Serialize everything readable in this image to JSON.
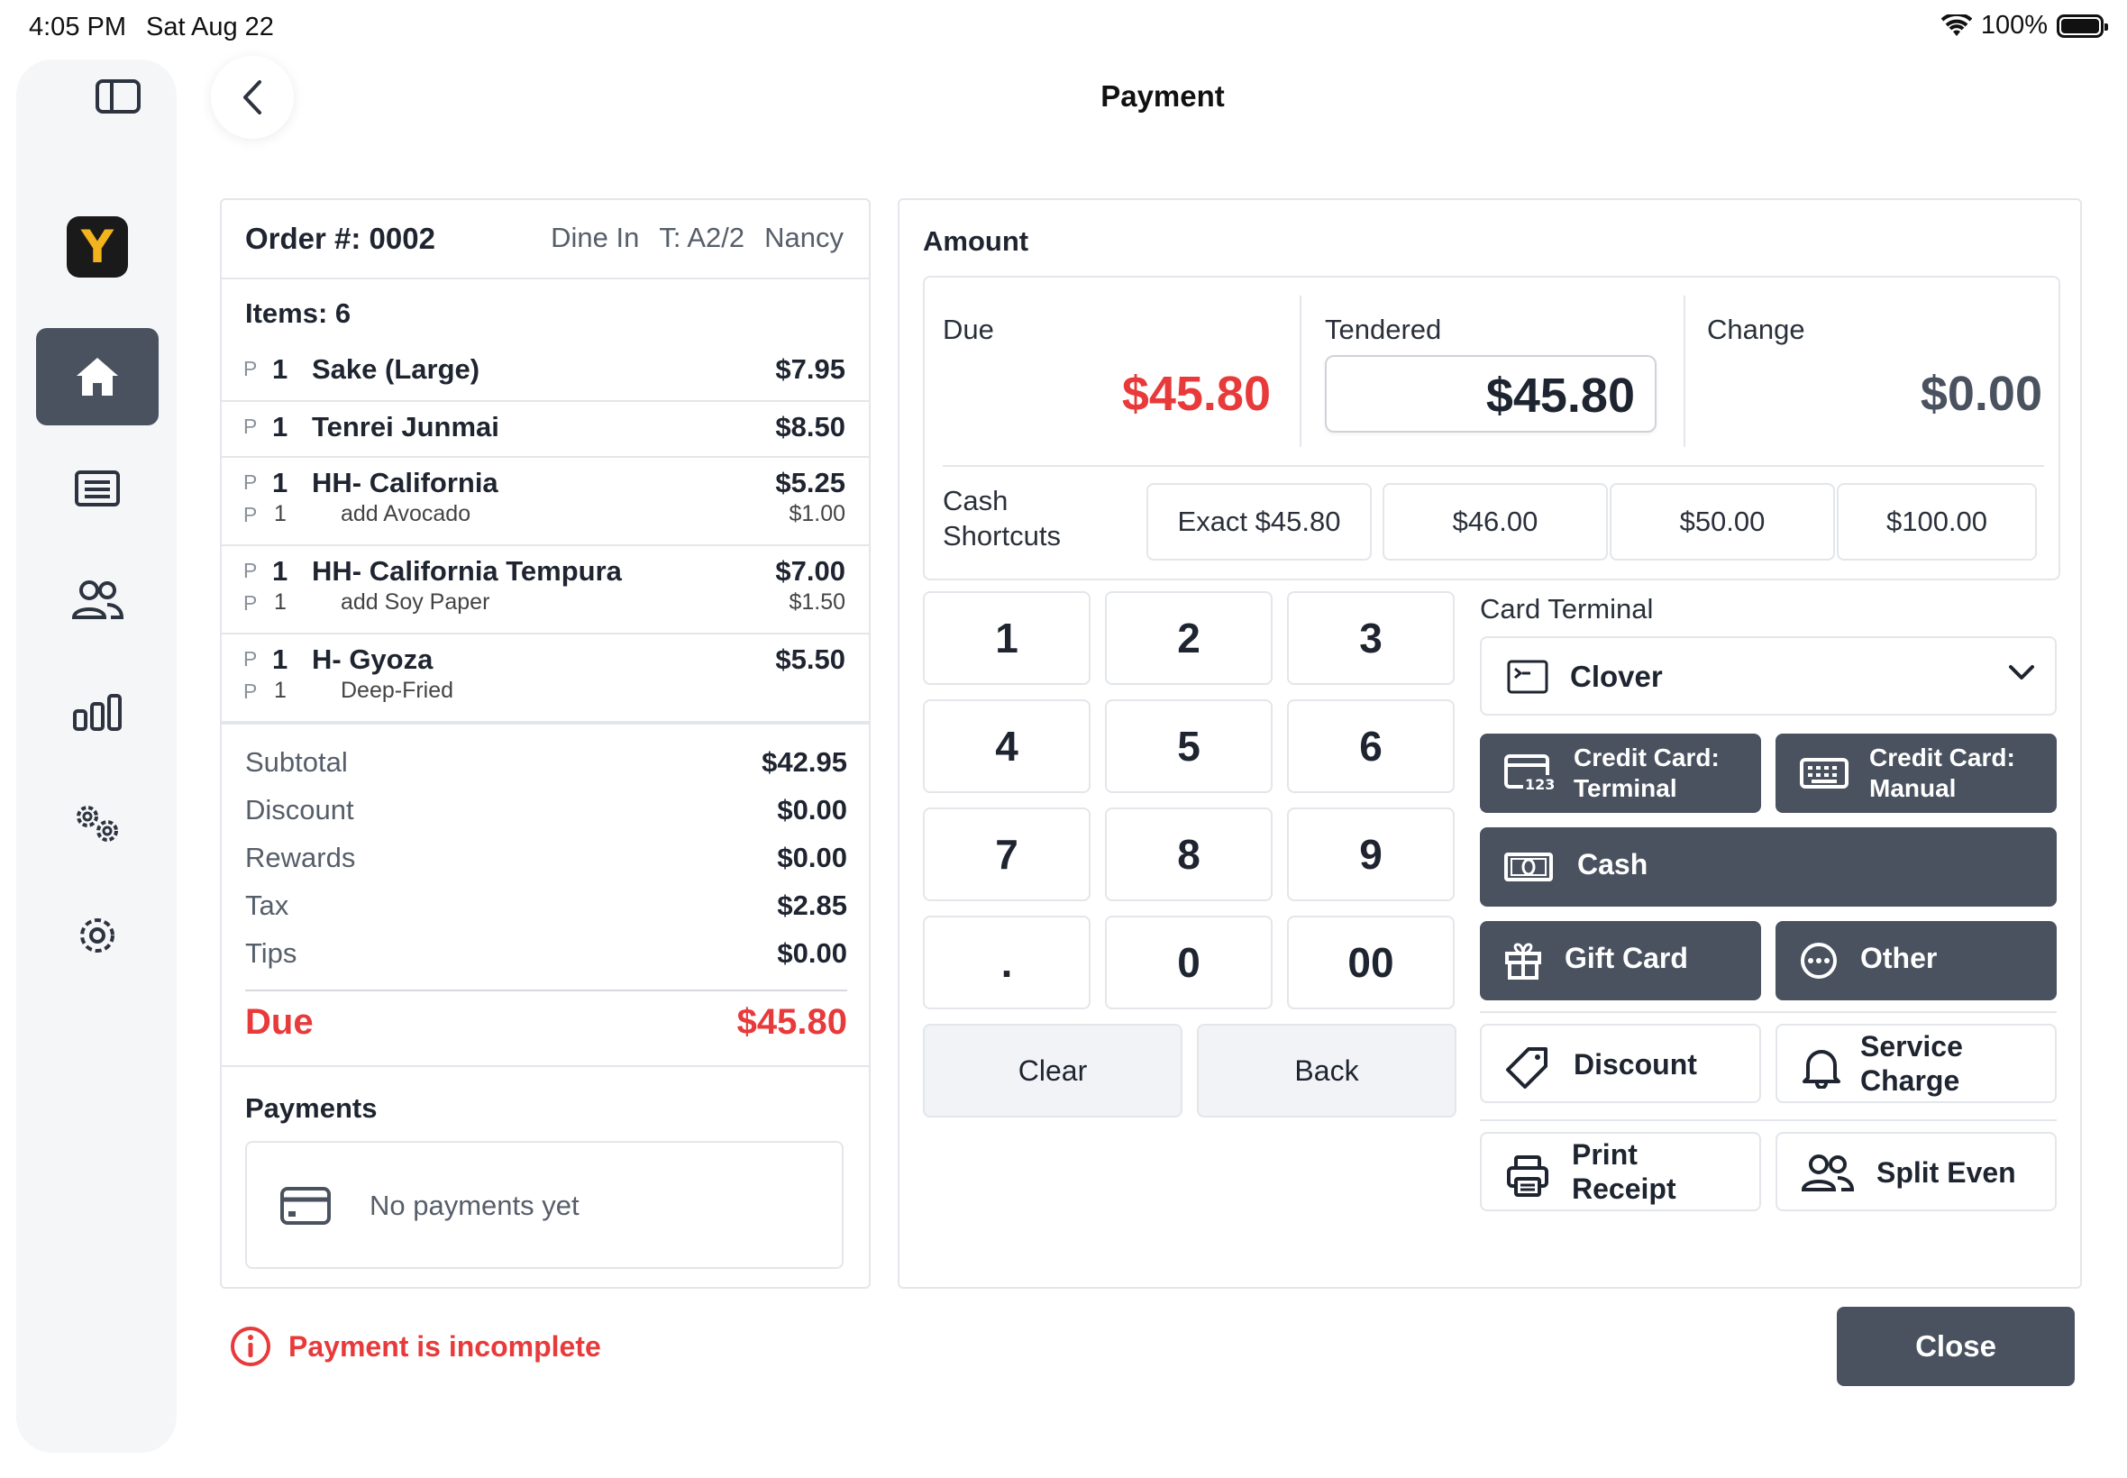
{
  "status_bar": {
    "time": "4:05 PM",
    "date": "Sat Aug 22",
    "battery": "100%"
  },
  "header": {
    "title": "Payment"
  },
  "sidebar": {
    "logo_letter": "Y",
    "items": [
      "home-icon",
      "orders-icon",
      "customers-icon",
      "reports-icon",
      "configuration-icon",
      "settings-icon"
    ]
  },
  "order": {
    "number": "Order #: 0002",
    "type": "Dine In",
    "table": "T: A2/2",
    "server": "Nancy",
    "items_count": "Items: 6",
    "items": [
      {
        "p": "P",
        "qty": "1",
        "name": "Sake (Large)",
        "price": "$7.95",
        "mods": []
      },
      {
        "p": "P",
        "qty": "1",
        "name": "Tenrei Junmai",
        "price": "$8.50",
        "mods": []
      },
      {
        "p": "P",
        "qty": "1",
        "name": "HH- California",
        "price": "$5.25",
        "mods": [
          {
            "p": "P",
            "qty": "1",
            "name": "add Avocado",
            "price": "$1.00"
          }
        ]
      },
      {
        "p": "P",
        "qty": "1",
        "name": "HH- California Tempura",
        "price": "$7.00",
        "mods": [
          {
            "p": "P",
            "qty": "1",
            "name": "add Soy Paper",
            "price": "$1.50"
          }
        ]
      },
      {
        "p": "P",
        "qty": "1",
        "name": "H- Gyoza",
        "price": "$5.50",
        "mods": [
          {
            "p": "P",
            "qty": "1",
            "name": "Deep-Fried",
            "price": ""
          }
        ]
      }
    ],
    "totals": [
      {
        "label": "Subtotal",
        "value": "$42.95"
      },
      {
        "label": "Discount",
        "value": "$0.00"
      },
      {
        "label": "Rewards",
        "value": "$0.00"
      },
      {
        "label": "Tax",
        "value": "$2.85"
      },
      {
        "label": "Tips",
        "value": "$0.00"
      }
    ],
    "due_label": "Due",
    "due_value": "$45.80",
    "payments_title": "Payments",
    "payments_empty": "No payments yet"
  },
  "amount": {
    "title": "Amount",
    "due_label": "Due",
    "due_value": "$45.80",
    "tendered_label": "Tendered",
    "tendered_value": "$45.80",
    "change_label": "Change",
    "change_value": "$0.00",
    "shortcuts_label_1": "Cash",
    "shortcuts_label_2": "Shortcuts",
    "shortcuts": [
      "Exact $45.80",
      "$46.00",
      "$50.00",
      "$100.00"
    ]
  },
  "keypad": {
    "keys": [
      "1",
      "2",
      "3",
      "4",
      "5",
      "6",
      "7",
      "8",
      "9",
      ".",
      "0",
      "00"
    ],
    "clear": "Clear",
    "back": "Back"
  },
  "methods": {
    "card_terminal_label": "Card Terminal",
    "terminal_selected": "Clover",
    "credit_terminal_1": "Credit Card:",
    "credit_terminal_2": "Terminal",
    "credit_manual_1": "Credit Card:",
    "credit_manual_2": "Manual",
    "cash": "Cash",
    "gift_card": "Gift Card",
    "other": "Other",
    "discount": "Discount",
    "service_charge_1": "Service",
    "service_charge_2": "Charge",
    "print_receipt_1": "Print",
    "print_receipt_2": "Receipt",
    "split_even": "Split Even"
  },
  "footer": {
    "warning": "Payment is incomplete",
    "close": "Close"
  },
  "colors": {
    "accent_dark": "#4a5260",
    "danger": "#e83a3a",
    "border": "#e3e6ea"
  }
}
